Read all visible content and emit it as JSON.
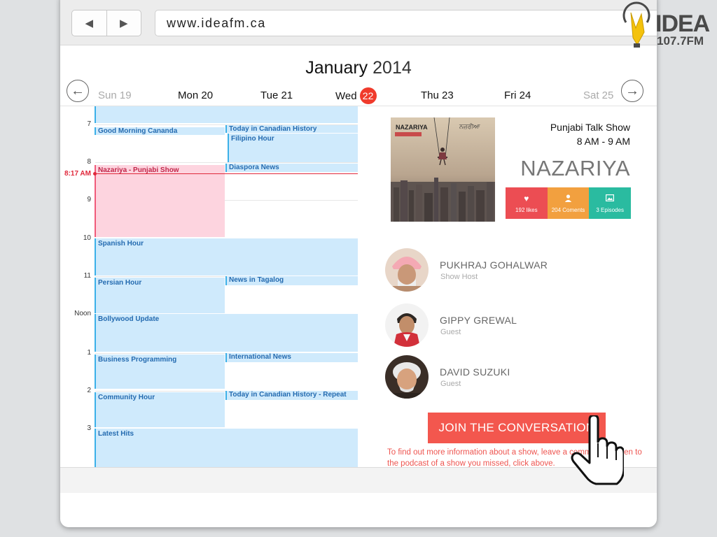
{
  "browser": {
    "back_icon": "back-arrow-icon",
    "forward_icon": "forward-arrow-icon",
    "url": "www.ideafm.ca"
  },
  "logo": {
    "name": "IDEA",
    "frequency": "107.7FM"
  },
  "calendar": {
    "month": "January",
    "year": "2014",
    "days": [
      {
        "label": "Sun 19",
        "dim": true
      },
      {
        "label": "Mon 20"
      },
      {
        "label": "Tue 21"
      },
      {
        "label": "Wed",
        "badge": "22"
      },
      {
        "label": "Thu 23"
      },
      {
        "label": "Fri 24"
      },
      {
        "label": "Sat 25",
        "dim": true
      }
    ],
    "hours": [
      "7",
      "8",
      "9",
      "10",
      "11",
      "Noon",
      "1",
      "2",
      "3"
    ],
    "now_label": "8:17 AM",
    "events": {
      "good_morning": "Good Morning Cananda",
      "today_in_history": "Today in Canadian History",
      "filipino_hour": "Filipino Hour",
      "diaspora_news": "Diaspora News",
      "nazariya": "Nazariya - Punjabi Show",
      "spanish_hour": "Spanish Hour",
      "persian_hour": "Persian Hour",
      "news_tagalog": "News in Tagalog",
      "bollywood": "Bollywood Update",
      "business": "Business Programming",
      "international_news": "International News",
      "community_hour": "Community Hour",
      "today_in_history_repeat": "Today in Canadian History - Repeat",
      "latest_hits": "Latest Hits"
    }
  },
  "show": {
    "art_title": "NAZARIYA",
    "art_title_punjabi": "ਨਜ਼ਰੀਆ",
    "type": "Punjabi Talk Show",
    "time": "8 AM - 9 AM",
    "name": "NAZARIYA",
    "stats": [
      {
        "icon": "heart-icon",
        "label": "192 likes"
      },
      {
        "icon": "person-icon",
        "label": "204 Coments"
      },
      {
        "icon": "image-icon",
        "label": "3 Episodes"
      }
    ]
  },
  "guests": [
    {
      "name": "PUKHRAJ GOHALWAR",
      "role": "Show Host"
    },
    {
      "name": "GIPPY GREWAL",
      "role": "Guest"
    },
    {
      "name": "DAVID SUZUKI",
      "role": "Guest"
    }
  ],
  "cta": {
    "button": "JOIN THE CONVERSATION",
    "info": "To find out more information about a show, leave a comment or listen to the podcast of a show you missed, click above."
  },
  "colors": {
    "accent_red": "#f3574e",
    "event_blue": "#cfeafc",
    "event_pink": "#fdd4df",
    "like_red": "#ec4d53",
    "comment_orange": "#f2a03f",
    "episode_teal": "#2abba0"
  }
}
